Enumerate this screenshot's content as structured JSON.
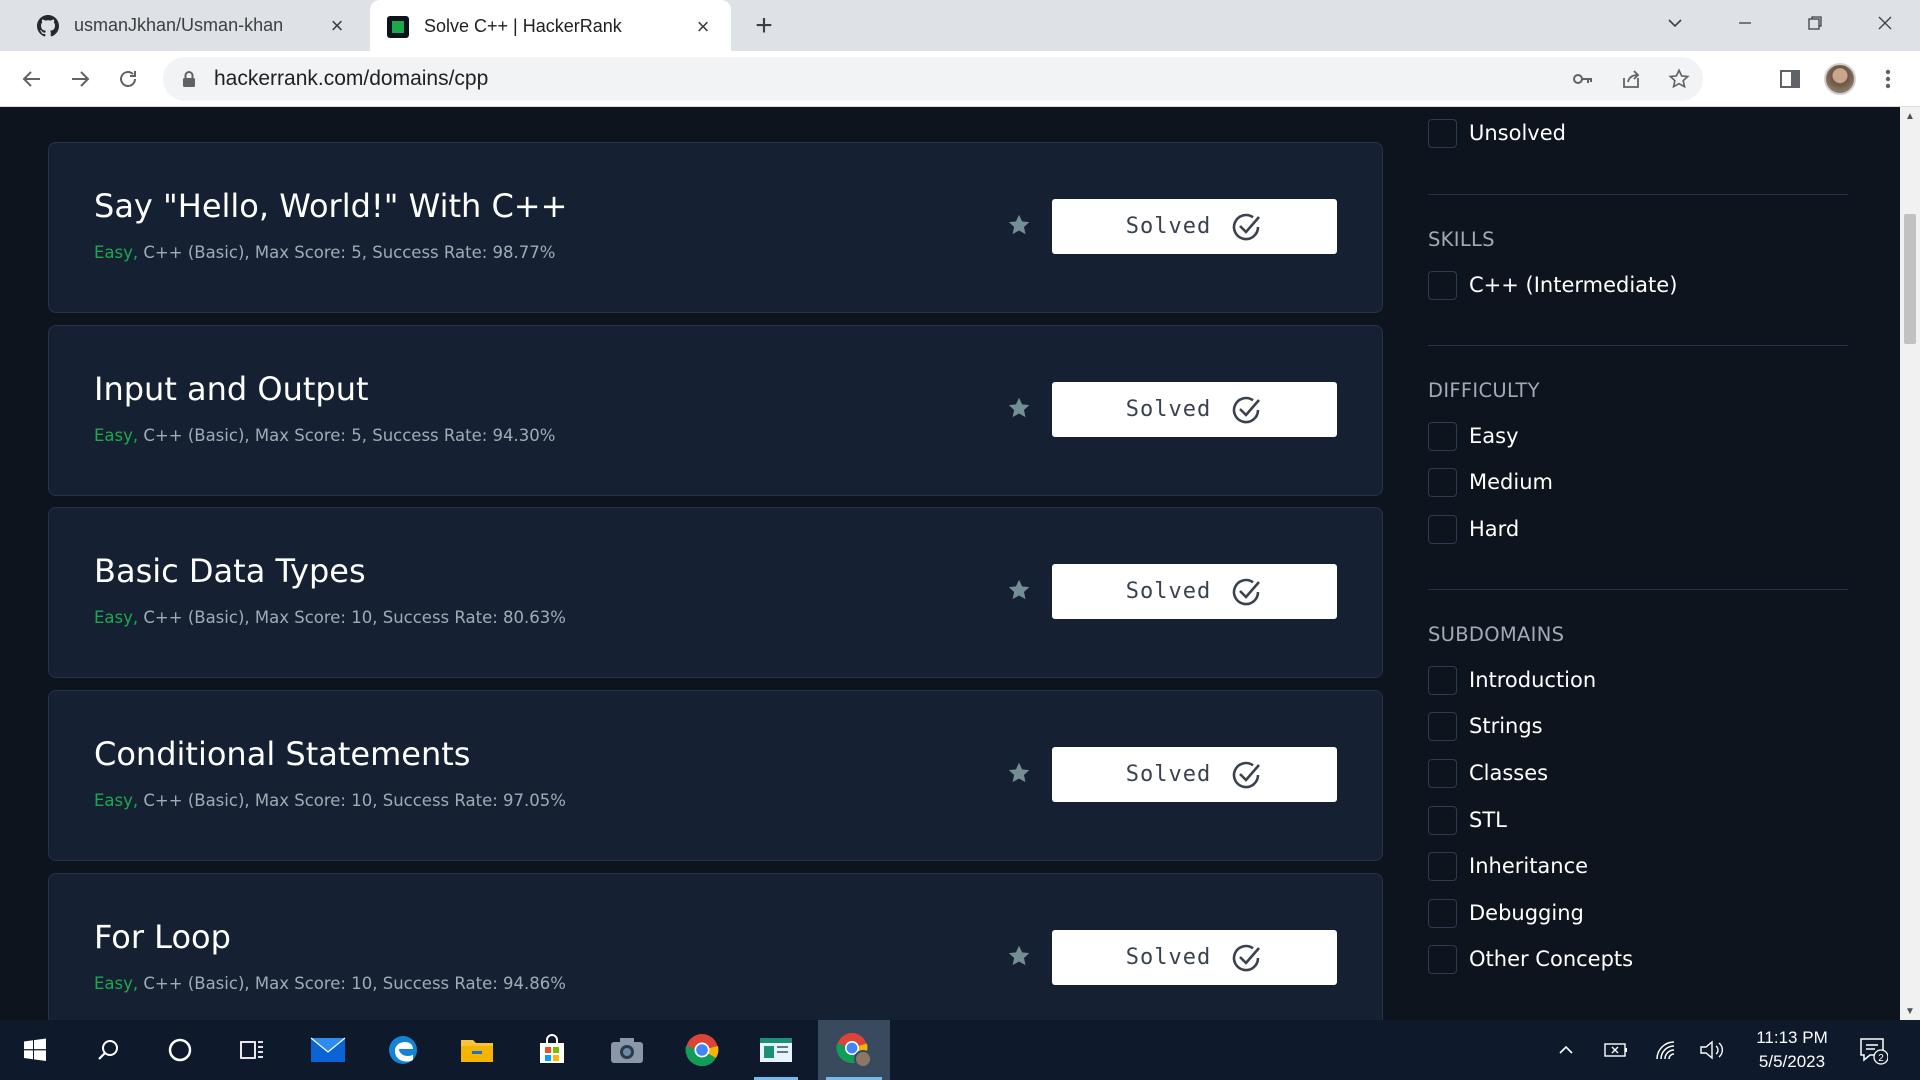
{
  "browser": {
    "tabs": [
      {
        "title": "usmanJkhan/Usman-khan",
        "icon": "github-icon",
        "active": false
      },
      {
        "title": "Solve C++ | HackerRank",
        "icon": "hackerrank-icon",
        "active": true
      }
    ],
    "url": "hackerrank.com/domains/cpp"
  },
  "challenges": [
    {
      "title": "Say \"Hello, World!\" With C++",
      "difficulty": "Easy,",
      "meta": " C++ (Basic), Max Score: 5, Success Rate: 98.77%",
      "status": "Solved"
    },
    {
      "title": "Input and Output",
      "difficulty": "Easy,",
      "meta": " C++ (Basic), Max Score: 5, Success Rate: 94.30%",
      "status": "Solved"
    },
    {
      "title": "Basic Data Types",
      "difficulty": "Easy,",
      "meta": " C++ (Basic), Max Score: 10, Success Rate: 80.63%",
      "status": "Solved"
    },
    {
      "title": "Conditional Statements",
      "difficulty": "Easy,",
      "meta": " C++ (Basic), Max Score: 10, Success Rate: 97.05%",
      "status": "Solved"
    },
    {
      "title": "For Loop",
      "difficulty": "Easy,",
      "meta": " C++ (Basic), Max Score: 10, Success Rate: 94.86%",
      "status": "Solved"
    }
  ],
  "filters": {
    "status": {
      "options": [
        "Unsolved"
      ]
    },
    "skills": {
      "heading": "SKILLS",
      "options": [
        "C++ (Intermediate)"
      ]
    },
    "difficulty": {
      "heading": "DIFFICULTY",
      "options": [
        "Easy",
        "Medium",
        "Hard"
      ]
    },
    "subdomains": {
      "heading": "SUBDOMAINS",
      "options": [
        "Introduction",
        "Strings",
        "Classes",
        "STL",
        "Inheritance",
        "Debugging",
        "Other Concepts"
      ]
    }
  },
  "taskbar": {
    "time": "11:13 PM",
    "date": "5/5/2023",
    "notification_count": "2",
    "apps": [
      "search",
      "cortana",
      "task-view",
      "mail",
      "edge",
      "file-explorer",
      "microsoft-store",
      "camera",
      "chrome",
      "app",
      "chrome-profile"
    ]
  },
  "colors": {
    "page_bg": "#0e141e",
    "card_bg": "#152033",
    "difficulty_easy": "#1ba94c",
    "meta_text": "#a3aab5"
  }
}
